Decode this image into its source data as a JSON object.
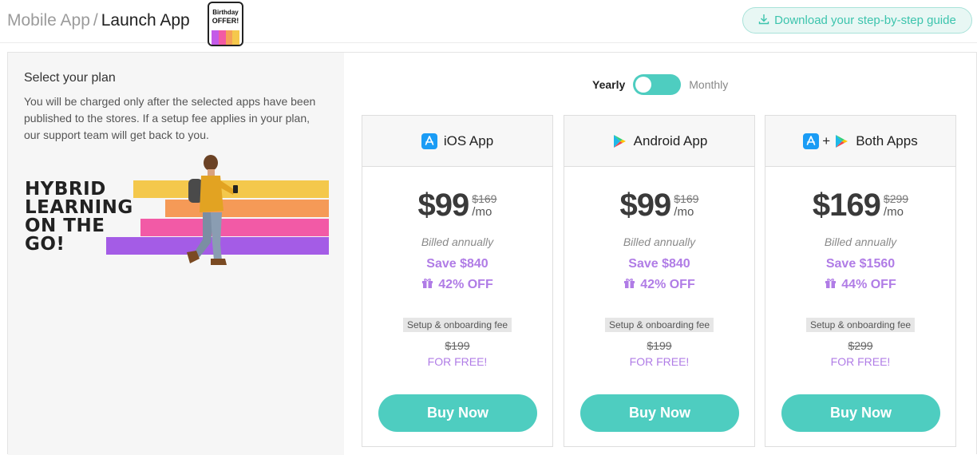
{
  "header": {
    "breadcrumb_parent": "Mobile App",
    "breadcrumb_separator": "/",
    "breadcrumb_current": "Launch App",
    "promo_line1": "Birthday",
    "promo_line2": "OFFER!",
    "promo_stripe_colors": [
      "#c35be8",
      "#f35aa3",
      "#f5a157",
      "#f5c84c"
    ],
    "guide_button": "Download your step-by-step guide",
    "guide_icon": "download-icon"
  },
  "left_panel": {
    "title": "Select your plan",
    "description": "You will be charged only after the selected apps have been published to the stores. If a setup fee applies in your plan, our support team will get back to you.",
    "hero_lines": [
      "HYBRID",
      "LEARNING",
      "ON THE",
      "GO!"
    ],
    "hero_band_colors": [
      "#f4c84c",
      "#f59a57",
      "#f25aa6",
      "#a45ce6"
    ]
  },
  "billing_toggle": {
    "yearly_label": "Yearly",
    "monthly_label": "Monthly",
    "selected": "Yearly"
  },
  "colors": {
    "accent": "#4ecdc0",
    "purple": "#b07ce6"
  },
  "plans": [
    {
      "name": "iOS App",
      "icon": "app-store-icon",
      "price": "$99",
      "old_price": "$169",
      "per": "/mo",
      "billed": "Billed annually",
      "save": "Save $840",
      "off": "42% OFF",
      "fee_label": "Setup & onboarding fee",
      "fee_old": "$199",
      "fee_free": "FOR FREE!",
      "button": "Buy Now"
    },
    {
      "name": "Android App",
      "icon": "google-play-icon",
      "price": "$99",
      "old_price": "$169",
      "per": "/mo",
      "billed": "Billed annually",
      "save": "Save $840",
      "off": "42% OFF",
      "fee_label": "Setup & onboarding fee",
      "fee_old": "$199",
      "fee_free": "FOR FREE!",
      "button": "Buy Now"
    },
    {
      "name": "Both Apps",
      "icon": "app-store-plus-google-play-icon",
      "plus": "+",
      "price": "$169",
      "old_price": "$299",
      "per": "/mo",
      "billed": "Billed annually",
      "save": "Save $1560",
      "off": "44% OFF",
      "fee_label": "Setup & onboarding fee",
      "fee_old": "$299",
      "fee_free": "FOR FREE!",
      "button": "Buy Now"
    }
  ]
}
